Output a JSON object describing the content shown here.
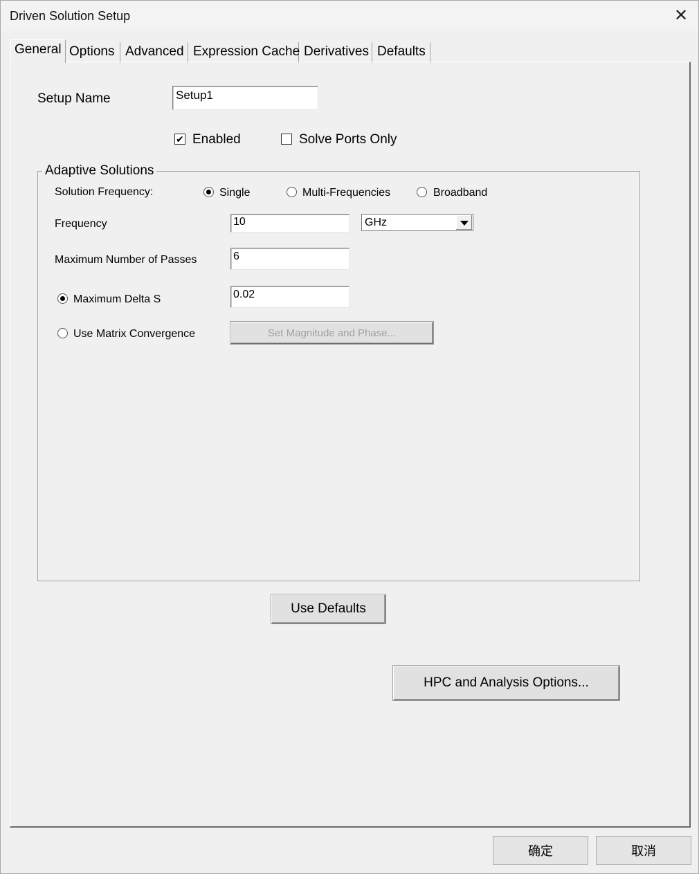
{
  "window": {
    "title": "Driven Solution Setup"
  },
  "tabs": [
    "General",
    "Options",
    "Advanced",
    "Expression Cache",
    "Derivatives",
    "Defaults"
  ],
  "general": {
    "setup_name_label": "Setup Name",
    "setup_name_value": "Setup1",
    "enabled_label": "Enabled",
    "enabled_checked": true,
    "solve_ports_only_label": "Solve Ports Only",
    "solve_ports_only_checked": false
  },
  "adaptive": {
    "group_title": "Adaptive Solutions",
    "solution_frequency_label": "Solution Frequency:",
    "freq_options": [
      "Single",
      "Multi-Frequencies",
      "Broadband"
    ],
    "freq_selected": "Single",
    "frequency_label": "Frequency",
    "frequency_value": "10",
    "frequency_unit": "GHz",
    "max_passes_label": "Maximum Number of Passes",
    "max_passes_value": "6",
    "max_delta_s_label": "Maximum Delta S",
    "max_delta_s_value": "0.02",
    "use_matrix_label": "Use Matrix Convergence",
    "convergence_selected": "Maximum Delta S",
    "set_mag_phase_label": "Set Magnitude and Phase..."
  },
  "buttons": {
    "use_defaults": "Use Defaults",
    "hpc_options": "HPC and Analysis Options...",
    "ok": "确定",
    "cancel": "取消"
  }
}
